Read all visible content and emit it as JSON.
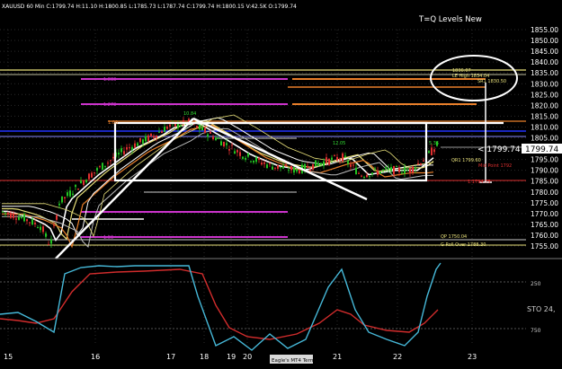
{
  "header": {
    "symbol_line": "XAUUSD 60 Min  C:1799.74  H:11.10  H:1800.85  L:1785.73  L:1787.74  C:1799.74  H:1800.15  V:42.5K  O:1799.74",
    "overlay_title": "T=Q Levels New"
  },
  "status": {
    "terminal": "Eagle's MT4 Terminal"
  },
  "price_axis": {
    "labels": [
      "1855.00",
      "1850.00",
      "1845.00",
      "1840.00",
      "1835.00",
      "1830.00",
      "1825.00",
      "1820.00",
      "1815.00",
      "1810.00",
      "1805.00",
      "1800.00",
      "1795.00",
      "1790.00",
      "1785.00",
      "1780.00",
      "1775.00",
      "1770.00",
      "1765.00",
      "1760.00",
      "1755.00"
    ],
    "current_price": "1799.74"
  },
  "time_axis": {
    "labels": [
      "15",
      "16",
      "17",
      "18",
      "19",
      "20",
      "21",
      "22",
      "23"
    ]
  },
  "oscillator": {
    "label": "STO 24,",
    "level_upper": "250",
    "level_lower": "750"
  },
  "annotations": {
    "pivot_high": "1836.07",
    "pivot_info_2": "LE High 1834.04",
    "pivot_info_3": "SR1 1830.50",
    "price_tag": "< 1799.74",
    "mid_right": "Mid Point 1792",
    "qr_label": "QR1 1799.60",
    "right_low": "G Roll Over 1788.30",
    "right_bottom": "G Roll Over 1788.30",
    "left_level_1": "1.833",
    "left_level_2": "1.272",
    "box_top": "1.00",
    "peak_label": "10.84",
    "mid_label": "12.05",
    "right_label": "5.35",
    "low_label": "1.1794.75",
    "left_bottom": "1.00",
    "qp": "QP 1750.04"
  },
  "colors": {
    "background": "#000000",
    "grid": "#3b3b3b",
    "bull": "#22c322",
    "bear": "#e03030",
    "level_orange": "#e97f2a",
    "level_magenta": "#cc33cc",
    "level_blue": "#2233ff",
    "level_yellow": "#e8e07a",
    "sto_fast": "#46b8d8",
    "sto_slow": "#d22c2c"
  }
}
